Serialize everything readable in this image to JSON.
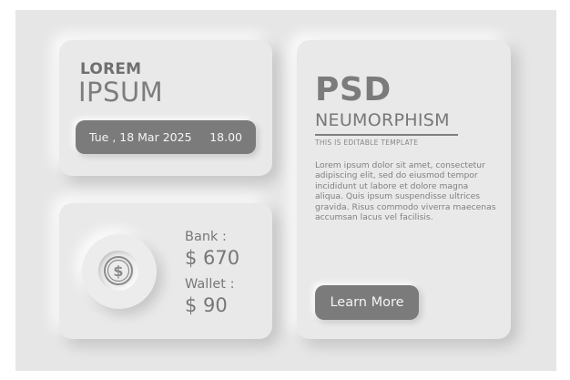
{
  "header_card": {
    "kicker": "LOREM",
    "heading": "IPSUM",
    "date": "Tue , 18 Mar 2025",
    "time": "18.00"
  },
  "balance_card": {
    "icon": "dollar-coin-icon",
    "bank_label": "Bank :",
    "bank_value": "$ 670",
    "wallet_label": "Wallet :",
    "wallet_value": "$ 90"
  },
  "info_card": {
    "title": "PSD",
    "subtitle": "NEUMORPHISM",
    "caption": "THIS IS EDITABLE TEMPLATE",
    "body": "Lorem ipsum dolor sit amet, consectetur adipiscing elit, sed do eiusmod tempor incididunt ut labore et dolore magna aliqua. Quis ipsum suspendisse ultrices gravida. Risus commodo viverra maecenas accumsan lacus vel facilisis.",
    "button_label": "Learn More"
  },
  "colors": {
    "background": "#e6e6e6",
    "card": "#e9e9e9",
    "accent_dark": "#7b7b7b",
    "text_gray": "#777777"
  }
}
